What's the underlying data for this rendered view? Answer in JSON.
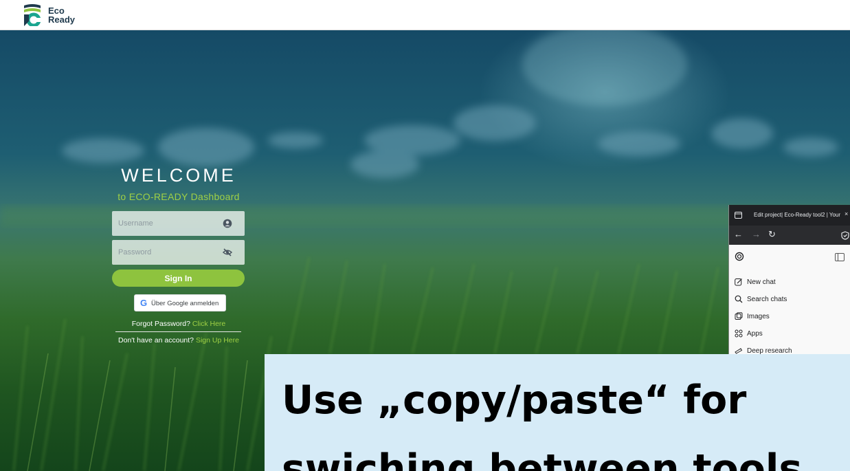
{
  "header": {
    "logo_line1": "Eco",
    "logo_line2": "Ready"
  },
  "login": {
    "welcome": "WELCOME",
    "subtitle": "to ECO-READY Dashboard",
    "username_placeholder": "Username",
    "password_placeholder": "Password",
    "signin_label": "Sign In",
    "google_label": "Über Google anmelden",
    "forgot_text": "Forgot Password?",
    "forgot_link": "Click Here",
    "signup_text": "Don't have an account?",
    "signup_link": "Sign Up Here"
  },
  "browser": {
    "tab_title": "Edit project| Eco-Ready tool2 | Your",
    "tab_close": "×",
    "sidebar_items": [
      {
        "label": "New chat",
        "icon": "pencil-square-icon"
      },
      {
        "label": "Search chats",
        "icon": "search-icon"
      },
      {
        "label": "Images",
        "icon": "images-icon"
      },
      {
        "label": "Apps",
        "icon": "apps-icon"
      },
      {
        "label": "Deep research",
        "icon": "telescope-icon"
      }
    ]
  },
  "caption": {
    "line1": "Use „copy/paste“ for",
    "line2": "swiching between tools"
  },
  "colors": {
    "accent_green": "#8ec33e",
    "link_green": "#9fd045",
    "caption_bg": "#d6ebf7"
  }
}
